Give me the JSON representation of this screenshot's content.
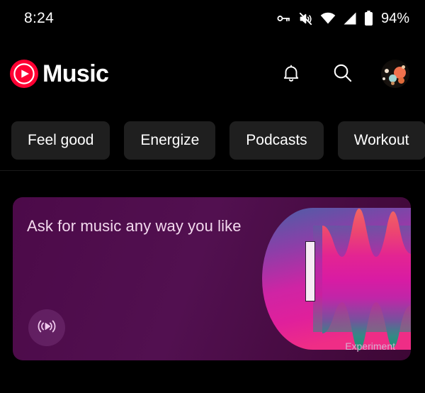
{
  "status_bar": {
    "time": "8:24",
    "battery_percent": "94%",
    "icons": [
      "vpn-key-icon",
      "volume-muted-icon",
      "wifi-icon",
      "cellular-signal-icon",
      "battery-icon"
    ]
  },
  "header": {
    "app_name": "Music",
    "logo": "youtube-music-logo",
    "actions": [
      {
        "name": "notifications-button",
        "icon": "bell-icon"
      },
      {
        "name": "search-button",
        "icon": "search-icon"
      },
      {
        "name": "account-avatar",
        "icon": "avatar-planets-image"
      }
    ]
  },
  "chips": [
    {
      "label": "Feel good"
    },
    {
      "label": "Energize"
    },
    {
      "label": "Podcasts"
    },
    {
      "label": "Workout"
    },
    {
      "label": ""
    }
  ],
  "promo_card": {
    "title": "Ask for music any way you like",
    "badge": "Experiment",
    "cast_icon": "broadcast-play-icon"
  },
  "colors": {
    "background": "#000000",
    "chip_bg": "#1f1f1f",
    "chip_text": "#ffffff",
    "brand_red": "#ff0033",
    "card_purple": "#521050",
    "card_text": "#f3d9ee",
    "badge_text": "#d7aed0",
    "wave_pink": "#e0209b",
    "wave_coral": "#f2566a",
    "wave_teal": "#17997d",
    "wave_blue": "#5b6fb0"
  }
}
